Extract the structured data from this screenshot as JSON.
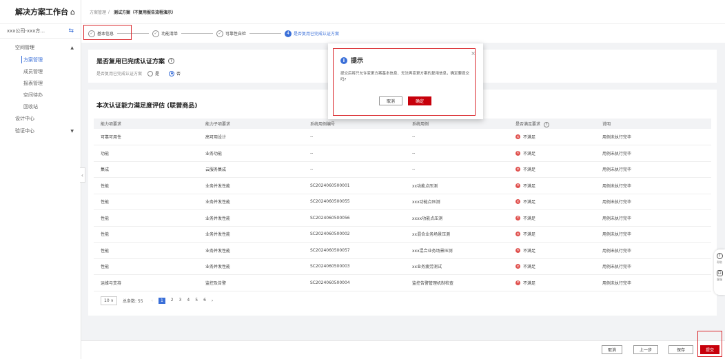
{
  "sidebar": {
    "title": "解决方案工作台",
    "home_icon": "⌂",
    "org": "xxx公司-xxx方...",
    "groups": [
      {
        "label": "空间管理",
        "arrow": "▲"
      },
      {
        "label": "设计中心"
      },
      {
        "label": "验证中心",
        "arrow": "▼"
      }
    ],
    "subitems": [
      "方案管理",
      "成员管理",
      "报表管理",
      "空间待办",
      "回收站"
    ]
  },
  "breadcrumb": {
    "root": "方案管理",
    "sep": "/",
    "current": "测试方案（不复用报告流程演示）"
  },
  "steps": [
    {
      "label": "基本信息",
      "mark": "✓"
    },
    {
      "label": "功能清单",
      "mark": "✓"
    },
    {
      "label": "可靠性自检",
      "mark": "✓"
    },
    {
      "label": "是否复用已完成认证方案",
      "mark": "4"
    }
  ],
  "reuse": {
    "title": "是否复用已完成认证方案",
    "help": "?",
    "question": "是否复用已完成认证方案",
    "yes": "是",
    "no": "否"
  },
  "evaluation": {
    "title": "本次认证能力满足度评估 (联营商品)",
    "headers": [
      "能力项要求",
      "能力子项要求",
      "系统用例编号",
      "系统用例",
      "是否满足要求",
      "说明"
    ],
    "rows": [
      [
        "可靠可用性",
        "高可用设计",
        "--",
        "--",
        "不满足",
        "用例未执行完毕"
      ],
      [
        "功能",
        "业务功能",
        "--",
        "--",
        "不满足",
        "用例未执行完毕"
      ],
      [
        "集成",
        "云服务集成",
        "--",
        "--",
        "不满足",
        "用例未执行完毕"
      ],
      [
        "性能",
        "业务并发性能",
        "SC2024060500001",
        "xx功能点压测",
        "不满足",
        "用例未执行完毕"
      ],
      [
        "性能",
        "业务并发性能",
        "SC2024060500055",
        "xxx功能点压测",
        "不满足",
        "用例未执行完毕"
      ],
      [
        "性能",
        "业务并发性能",
        "SC2024060500056",
        "xxxx功能点压测",
        "不满足",
        "用例未执行完毕"
      ],
      [
        "性能",
        "业务并发性能",
        "SC2024060500002",
        "xx混合业务场景压测",
        "不满足",
        "用例未执行完毕"
      ],
      [
        "性能",
        "业务并发性能",
        "SC2024060500057",
        "xxx混合业务场景压测",
        "不满足",
        "用例未执行完毕"
      ],
      [
        "性能",
        "业务并发性能",
        "SC2024060500003",
        "xx业务疲劳测试",
        "不满足",
        "用例未执行完毕"
      ],
      [
        "运维与支持",
        "监控及告警",
        "SC2024060500004",
        "监控告警管理机制检查",
        "不满足",
        "用例未执行完毕"
      ]
    ],
    "pager": {
      "size": "10",
      "total": "总条数: 55",
      "pages": [
        "1",
        "2",
        "3",
        "4",
        "5",
        "6"
      ]
    }
  },
  "footer": {
    "cancel": "取消",
    "prev": "上一步",
    "save": "保存",
    "submit": "提交"
  },
  "float": {
    "help": "帮助",
    "service": "客服"
  },
  "modal": {
    "title": "提示",
    "body": "提交后将只允许变更方案基本信息、无法再变更方案的复用信息，确定要提交吗?",
    "cancel": "取消",
    "ok": "确定"
  },
  "colors": {
    "accent": "#3a6fd8",
    "primary": "#c7000b",
    "highlight": "#d9262b"
  }
}
